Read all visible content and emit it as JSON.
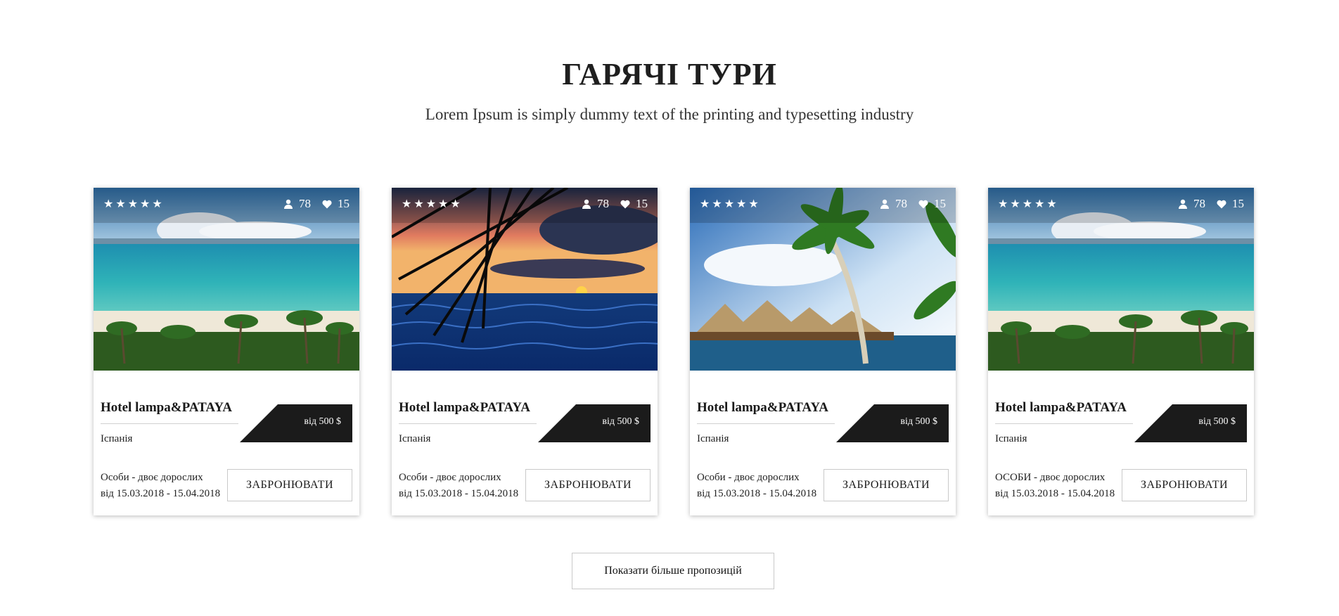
{
  "section": {
    "title": "ГАРЯЧІ ТУРИ",
    "subtitle": "Lorem Ipsum is simply dummy text of the printing and typesetting industry"
  },
  "cards": [
    {
      "image": "beach-palms",
      "stars": "★★★★★",
      "rating": 5,
      "views": "78",
      "likes": "15",
      "hotel": "Hotel lampa&PATAYA",
      "country": "Іспанія",
      "price": "від 500 $",
      "persons": "Особи - двоє дорослих",
      "dates": "від 15.03.2018 - 15.04.2018",
      "book_label": "ЗАБРОНЮВАТИ"
    },
    {
      "image": "ocean-sunset",
      "stars": "★★★★★",
      "rating": 5,
      "views": "78",
      "likes": "15",
      "hotel": "Hotel lampa&PATAYA",
      "country": "Іспанія",
      "price": "від 500 $",
      "persons": "Особи - двоє дорослих",
      "dates": "від 15.03.2018 - 15.04.2018",
      "book_label": "ЗАБРОНЮВАТИ"
    },
    {
      "image": "palm-huts",
      "stars": "★★★★★",
      "rating": 5,
      "views": "78",
      "likes": "15",
      "hotel": "Hotel lampa&PATAYA",
      "country": "Іспанія",
      "price": "від 500 $",
      "persons": "Особи - двоє дорослих",
      "dates": "від 15.03.2018 - 15.04.2018",
      "book_label": "ЗАБРОНЮВАТИ"
    },
    {
      "image": "beach-palms",
      "stars": "★★★★★",
      "rating": 5,
      "views": "78",
      "likes": "15",
      "hotel": "Hotel lampa&PATAYA",
      "country": "Іспанія",
      "price": "від 500 $",
      "persons": "ОСОБИ - двоє дорослих",
      "dates": "від 15.03.2018 - 15.04.2018",
      "book_label": "ЗАБРОНЮВАТИ"
    }
  ],
  "icons": {
    "views": "user-icon",
    "likes": "heart-icon"
  },
  "colors": {
    "price_tag": "#1b1b1b",
    "title": "#1f1f1f"
  },
  "more_button": "Показати більше пропозицій"
}
